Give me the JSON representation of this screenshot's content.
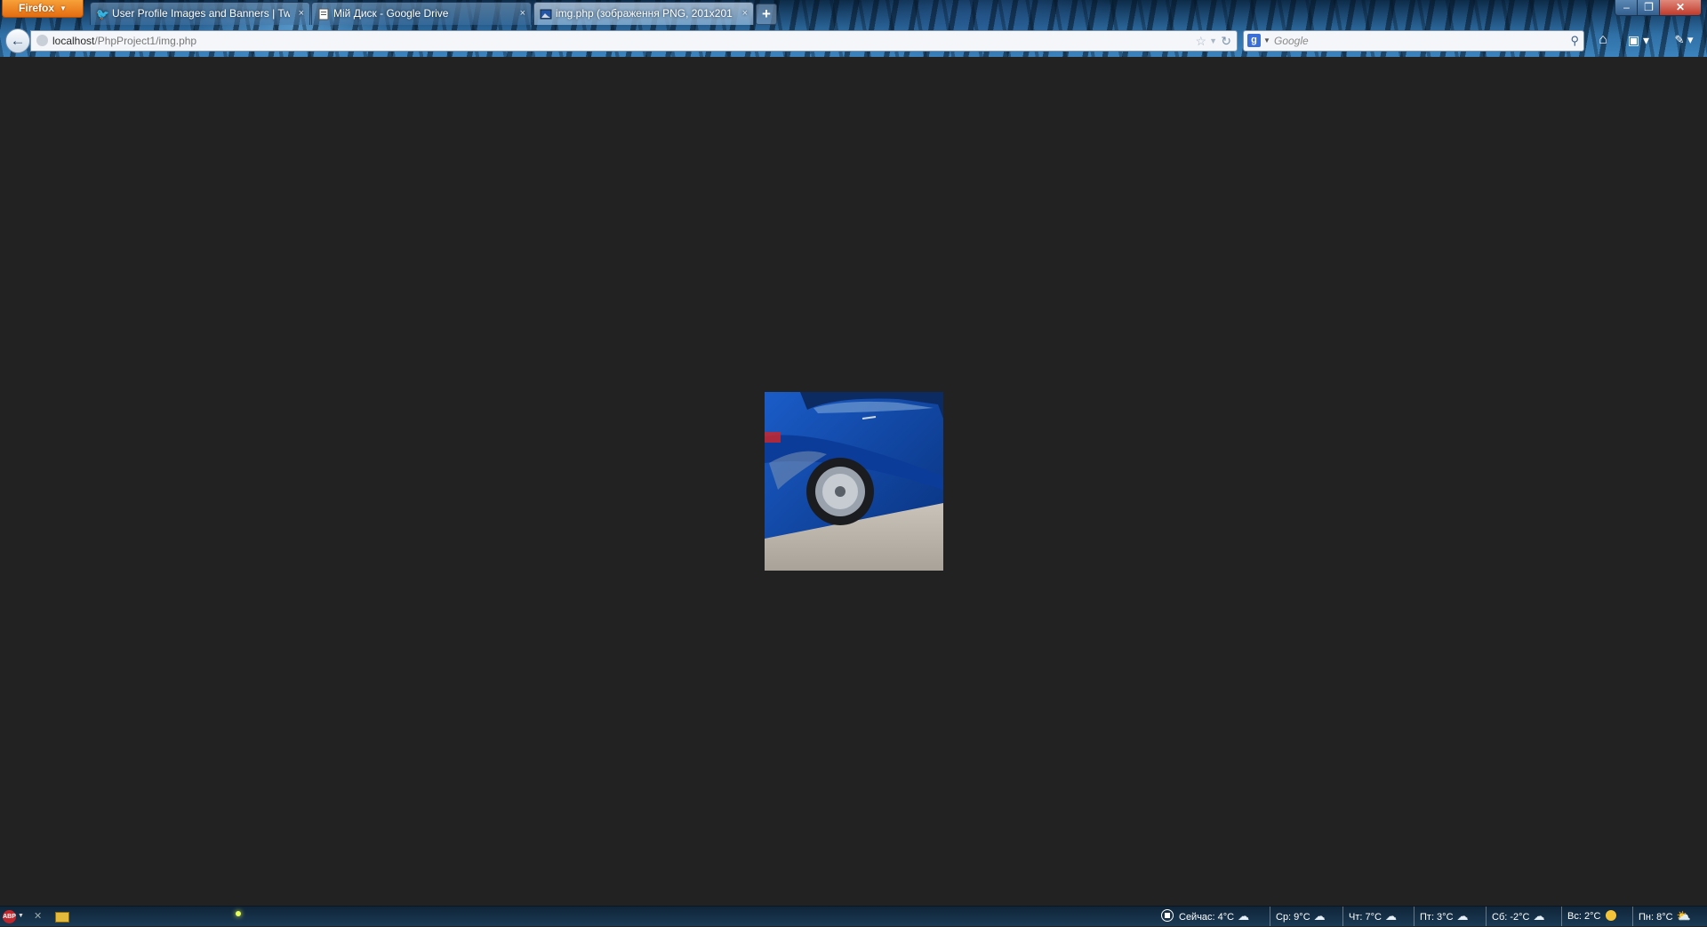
{
  "browser": {
    "menu_button": "Firefox",
    "tabs": [
      {
        "title": "User Profile Images and Banners | Twi...",
        "icon": "twitter-bird-icon",
        "active": false
      },
      {
        "title": "Мій Диск - Google Drive",
        "icon": "google-drive-icon",
        "active": false
      },
      {
        "title": "img.php (зображення PNG, 201x201 ...",
        "icon": "image-icon",
        "active": true
      }
    ],
    "url_host": "localhost",
    "url_path": "/PhpProject1/img.php",
    "search_placeholder": "Google"
  },
  "content": {
    "image_alt": "car wheel blur",
    "image_dims": "201x201"
  },
  "statusbar": {
    "weather_now": "Сейчас: 4°C",
    "forecast": [
      {
        "label": "Ср: 9°C",
        "icon": "cloud-icon"
      },
      {
        "label": "Чт: 7°C",
        "icon": "cloud-icon"
      },
      {
        "label": "Пт: 3°C",
        "icon": "cloud-icon"
      },
      {
        "label": "Сб: -2°C",
        "icon": "cloud-icon"
      },
      {
        "label": "Вс: 2°C",
        "icon": "sun-icon"
      },
      {
        "label": "Пн: 8°C",
        "icon": "sun-cloud-icon"
      }
    ]
  },
  "colors": {
    "page_background": "#222222",
    "firefox_button": "#e46c10",
    "car_blue": "#0f46a8"
  }
}
